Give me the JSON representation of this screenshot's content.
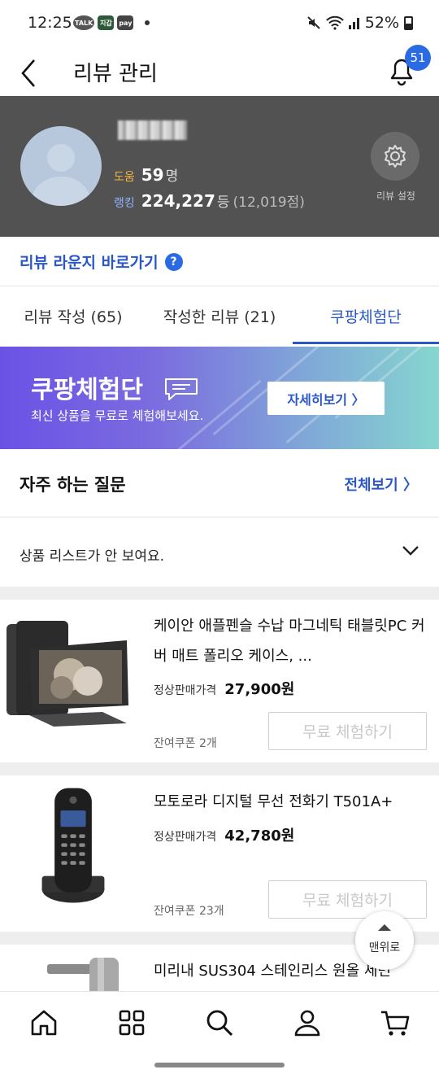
{
  "status_bar": {
    "time": "12:25",
    "apps": [
      "TALK",
      "지갑",
      "pay"
    ],
    "battery": "52%"
  },
  "header": {
    "title": "리뷰 관리",
    "notification_count": "51"
  },
  "profile": {
    "help_label": "도움",
    "help_count": "59",
    "help_unit": "명",
    "rank_label": "랭킹",
    "rank_value": "224,227",
    "rank_unit": "등",
    "rank_points": "(12,019점)",
    "settings_label": "리뷰 설정"
  },
  "lounge": {
    "link_text": "리뷰 라운지 바로가기"
  },
  "tabs": [
    {
      "label": "리뷰 작성 (65)"
    },
    {
      "label": "작성한 리뷰 (21)"
    },
    {
      "label": "쿠팡체험단"
    }
  ],
  "banner": {
    "title": "쿠팡체험단",
    "subtitle": "최신 상품을 무료로 체험해보세요.",
    "button": "자세히보기 〉"
  },
  "faq": {
    "title": "자주 하는 질문",
    "view_all": "전체보기 〉",
    "question": "상품 리스트가 안 보여요."
  },
  "products": [
    {
      "name": "케이안 애플펜슬 수납 마그네틱 태블릿PC 커버 매트 폴리오 케이스, ...",
      "price_label": "정상판매가격",
      "price": "27,900원",
      "coupon": "잔여쿠폰 2개",
      "button": "무료 체험하기"
    },
    {
      "name": "모토로라 디지털 무선 전화기 T501A+",
      "price_label": "정상판매가격",
      "price": "42,780원",
      "coupon": "잔여쿠폰 23개",
      "button": "무료 체험하기"
    },
    {
      "name": "미리내 SUS304 스테인리스 원올 세면"
    }
  ],
  "scroll_top": {
    "label": "맨위로"
  },
  "bottom_nav": [
    "home-icon",
    "category-icon",
    "search-icon",
    "user-icon",
    "cart-icon"
  ],
  "colors": {
    "accent": "#2a57c8",
    "profile_bg": "#525252",
    "help_label": "#f0b63c",
    "rank_label": "#8fb4ff"
  }
}
